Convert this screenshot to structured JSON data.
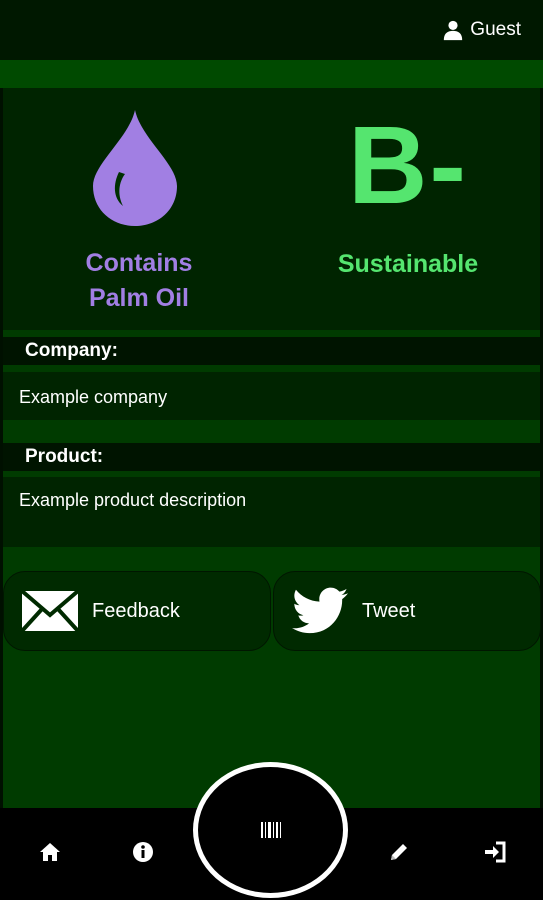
{
  "header": {
    "user_label": "Guest",
    "user_icon": "person-icon"
  },
  "hero": {
    "palm_oil_label_line1": "Contains",
    "palm_oil_label_line2": "Palm Oil",
    "palm_oil_icon": "drop-icon",
    "grade": "B-",
    "rating_label": "Sustainable",
    "colors": {
      "palm": "#a17fe3",
      "grade": "#55e56f"
    }
  },
  "company": {
    "label": "Company:",
    "value": "Example company"
  },
  "product": {
    "label": "Product:",
    "value": "Example product description"
  },
  "actions": {
    "feedback_label": "Feedback",
    "feedback_icon": "envelope-icon",
    "tweet_label": "Tweet",
    "tweet_icon": "twitter-bird-icon"
  },
  "nav": {
    "items": [
      "home-icon",
      "info-icon",
      "barcode-icon",
      "pencil-icon",
      "sign-in-icon"
    ]
  }
}
